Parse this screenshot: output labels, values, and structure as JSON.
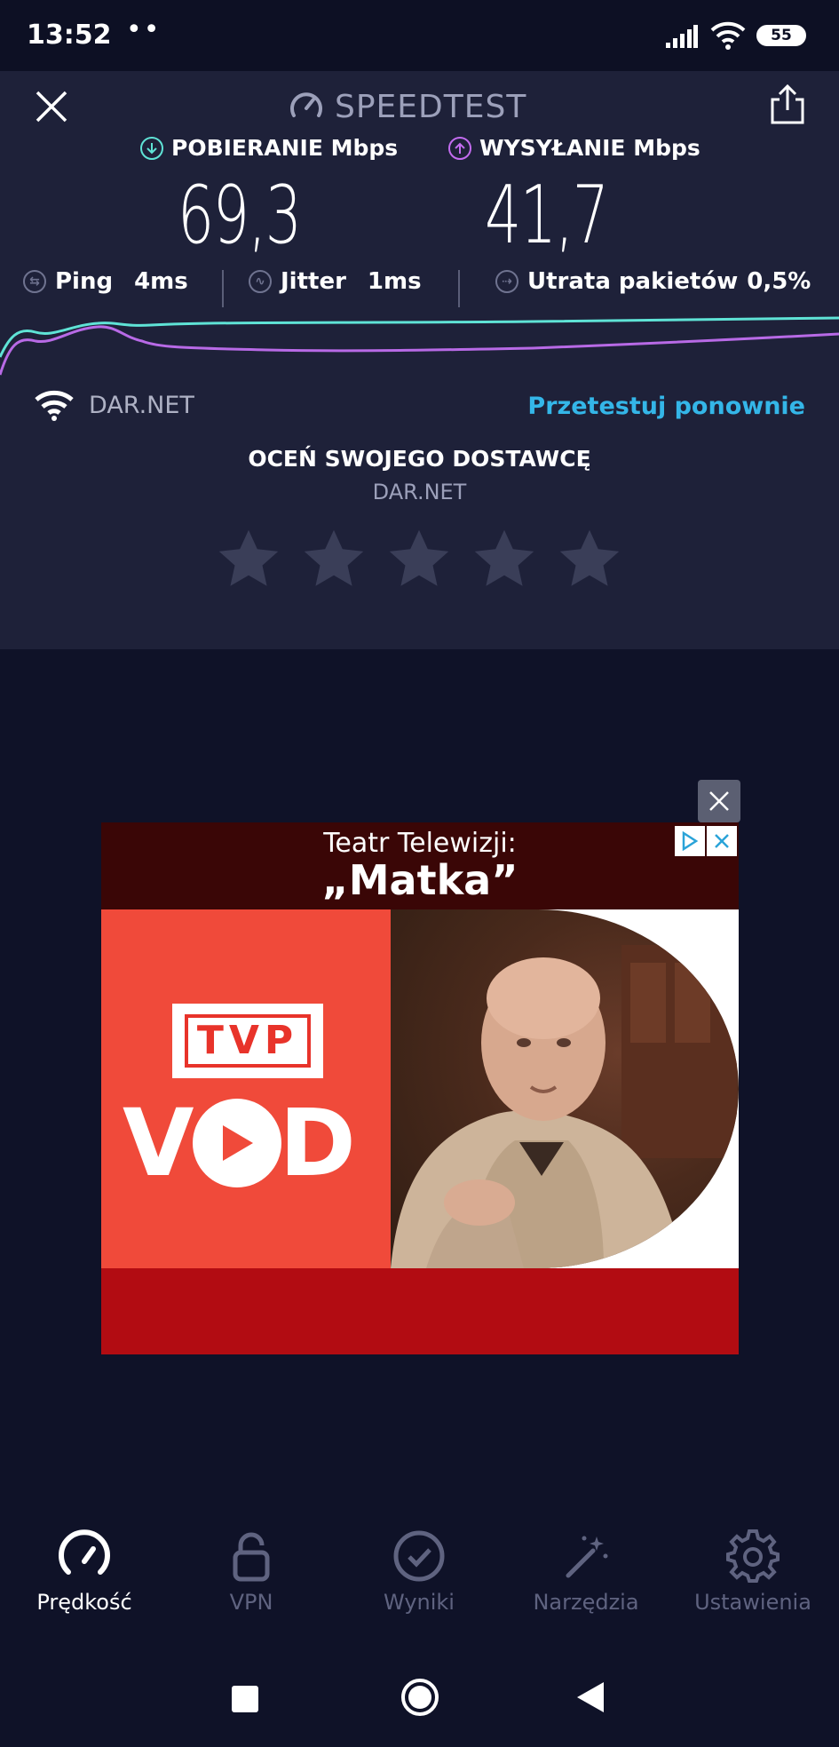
{
  "status_bar": {
    "time": "13:52",
    "dots": "••",
    "battery": "55"
  },
  "header": {
    "title": "SPEEDTEST"
  },
  "download": {
    "label": "POBIERANIE Mbps",
    "value": "69,3",
    "color": "#5fe3d6"
  },
  "upload": {
    "label": "WYSYŁANIE Mbps",
    "value": "41,7",
    "color": "#c36cf0"
  },
  "stats": {
    "ping_label": "Ping",
    "ping_value": "4ms",
    "jitter_label": "Jitter",
    "jitter_value": "1ms",
    "loss_label": "Utrata pakietów",
    "loss_value": "0,5%"
  },
  "isp": {
    "name": "DAR.NET",
    "retest_label": "Przetestuj ponownie"
  },
  "rating": {
    "title": "OCEŃ SWOJEGO DOSTAWCĘ",
    "isp": "DAR.NET",
    "stars_total": 5,
    "stars_filled": 0
  },
  "ad": {
    "line1": "Teatr Telewizji:",
    "line2": "„Matka”",
    "logo_text": "TVP VOD"
  },
  "nav": {
    "items": [
      {
        "label": "Prędkość",
        "icon": "speedometer-icon",
        "active": true
      },
      {
        "label": "VPN",
        "icon": "lock-icon",
        "active": false
      },
      {
        "label": "Wyniki",
        "icon": "check-circle-icon",
        "active": false
      },
      {
        "label": "Narzędzia",
        "icon": "magic-wand-icon",
        "active": false
      },
      {
        "label": "Ustawienia",
        "icon": "gear-icon",
        "active": false
      }
    ]
  }
}
